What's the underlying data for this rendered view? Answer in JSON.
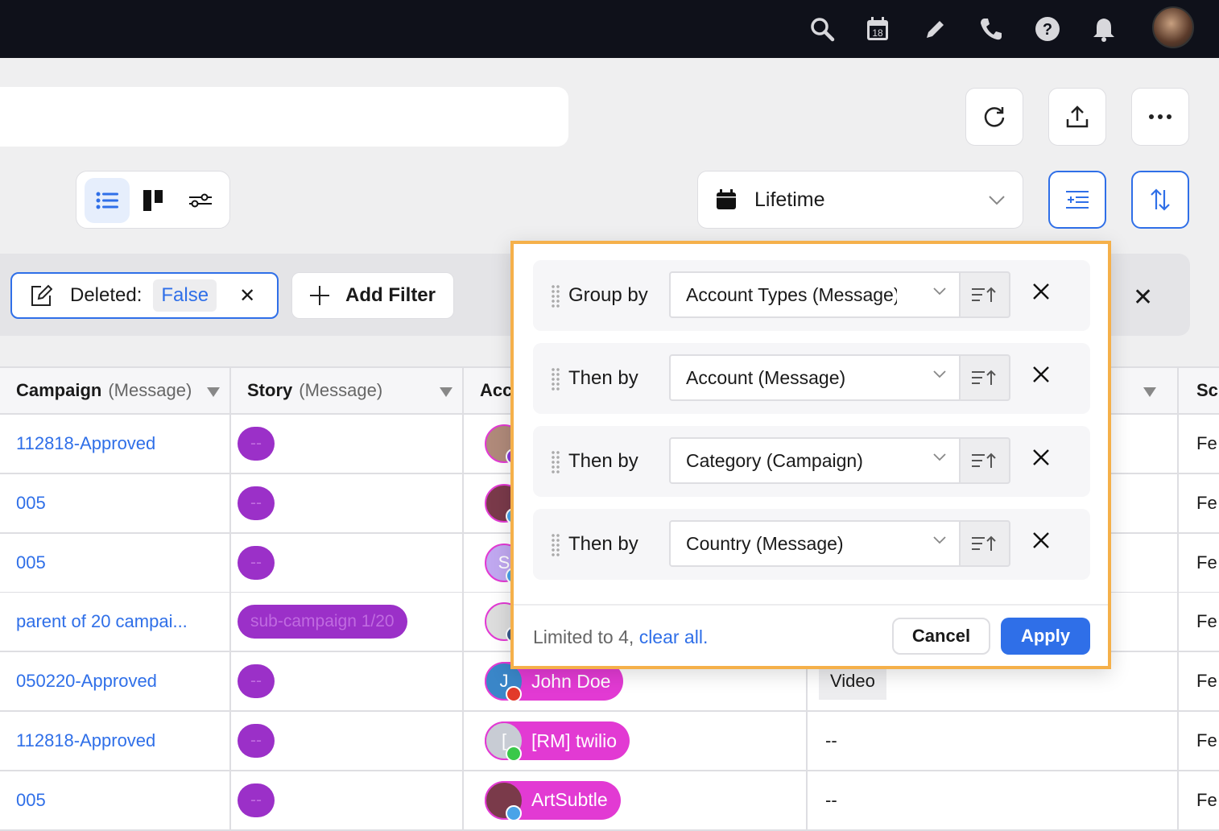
{
  "topbar": {
    "icons": [
      "search-icon",
      "calendar-icon",
      "pencil-icon",
      "phone-icon",
      "help-icon",
      "bell-icon"
    ],
    "calendar_day": "18"
  },
  "toolbar": {
    "date_range": "Lifetime"
  },
  "filters": {
    "deleted_label": "Deleted:",
    "deleted_value": "False",
    "add_filter": "Add Filter"
  },
  "table": {
    "columns": [
      {
        "title": "Campaign",
        "sub": "(Message)"
      },
      {
        "title": "Story",
        "sub": "(Message)"
      },
      {
        "title": "Acc",
        "sub": ""
      },
      {
        "title": "",
        "sub": ""
      },
      {
        "title": "Sc",
        "sub": ""
      }
    ],
    "rows": [
      {
        "campaign": "112818-Approved",
        "story": "--",
        "account": "",
        "col4": "",
        "sc": "Fe"
      },
      {
        "campaign": "005",
        "story": "--",
        "account": "",
        "col4": "",
        "sc": "Fe"
      },
      {
        "campaign": "005",
        "story": "--",
        "account": "",
        "avatar_letter": "S",
        "col4": "",
        "sc": "Fe"
      },
      {
        "campaign": "parent of 20 campai...",
        "story": "sub-campaign 1/20",
        "account": "",
        "col4": "",
        "sc": "Fe"
      },
      {
        "campaign": "050220-Approved",
        "story": "--",
        "account": "John Doe",
        "avatar_letter": "J",
        "col4": "Video",
        "sc": "Fe"
      },
      {
        "campaign": "112818-Approved",
        "story": "--",
        "account": "[RM] twilio",
        "avatar_letter": "[",
        "col4": "--",
        "sc": "Fe"
      },
      {
        "campaign": "005",
        "story": "--",
        "account": "ArtSubtle",
        "col4": "--",
        "sc": "Fe"
      }
    ]
  },
  "group_popup": {
    "rows": [
      {
        "label": "Group by",
        "value": "Account Types (Message)"
      },
      {
        "label": "Then by",
        "value": "Account (Message)"
      },
      {
        "label": "Then by",
        "value": "Category (Campaign)"
      },
      {
        "label": "Then by",
        "value": "Country (Message)"
      }
    ],
    "limit_text": "Limited to 4,",
    "clear_all": "clear all.",
    "cancel": "Cancel",
    "apply": "Apply"
  },
  "colors": {
    "accent": "#2f6fe8",
    "highlight": "#f5b04a",
    "story_chip": "#9b30c8",
    "account_chip": "#e23ad3"
  }
}
